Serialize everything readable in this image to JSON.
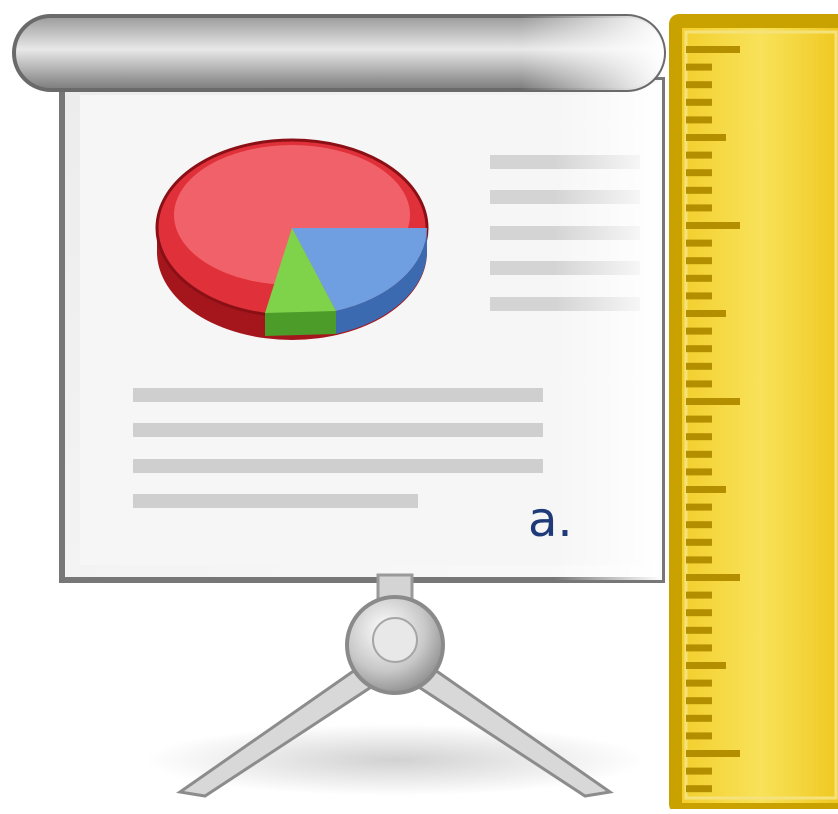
{
  "item_label": "a.",
  "icons": {
    "presentation": "presentation-icon",
    "ruler": "ruler-icon"
  },
  "colors": {
    "label_text": "#1f3a78",
    "pie_red": "#e0303a",
    "pie_green": "#7ed34a",
    "pie_blue": "#6f9fe0",
    "ruler_fill": "#f5d848",
    "ruler_border": "#c9a200"
  }
}
